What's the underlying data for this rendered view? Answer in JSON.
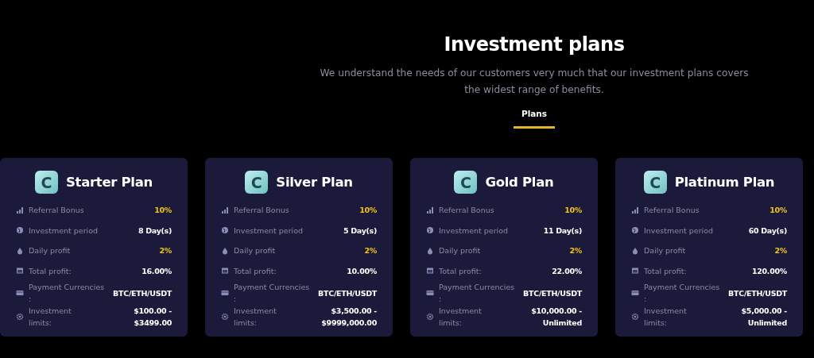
{
  "header": {
    "title": "Investment plans",
    "subtitle": "We understand the needs of our customers very much that our investment plans covers the widest range of benefits."
  },
  "tabs": [
    {
      "label": "Plans",
      "selected": true
    }
  ],
  "plans": [
    {
      "name": "Starter Plan",
      "logo": "C",
      "rows": [
        {
          "kind": "bars",
          "label": "Referral Bonus",
          "value": "10%",
          "highlight": true
        },
        {
          "kind": "globe",
          "label": "Investment period",
          "value": "8 Day(s)",
          "highlight": false
        },
        {
          "kind": "drop",
          "label": "Daily profit",
          "value": "2%",
          "highlight": true
        },
        {
          "kind": "calendar",
          "label": "Total profit:",
          "value": "16.00%",
          "highlight": false
        },
        {
          "kind": "card",
          "label": "Payment Currencies :",
          "value": "BTC/ETH/USDT",
          "highlight": false
        },
        {
          "kind": "gear",
          "label": "Investment limits:",
          "value": "$100.00 - $3499.00",
          "highlight": false
        }
      ]
    },
    {
      "name": "Silver Plan",
      "logo": "C",
      "rows": [
        {
          "kind": "bars",
          "label": "Referral Bonus",
          "value": "10%",
          "highlight": true
        },
        {
          "kind": "globe",
          "label": "Investment period",
          "value": "5 Day(s)",
          "highlight": false
        },
        {
          "kind": "drop",
          "label": "Daily profit",
          "value": "2%",
          "highlight": true
        },
        {
          "kind": "calendar",
          "label": "Total profit:",
          "value": "10.00%",
          "highlight": false
        },
        {
          "kind": "card",
          "label": "Payment Currencies :",
          "value": "BTC/ETH/USDT",
          "highlight": false
        },
        {
          "kind": "gear",
          "label": "Investment limits:",
          "value": "$3,500.00 - $9999,000.00",
          "highlight": false
        }
      ]
    },
    {
      "name": "Gold Plan",
      "logo": "C",
      "rows": [
        {
          "kind": "bars",
          "label": "Referral Bonus",
          "value": "10%",
          "highlight": true
        },
        {
          "kind": "globe",
          "label": "Investment period",
          "value": "11 Day(s)",
          "highlight": false
        },
        {
          "kind": "drop",
          "label": "Daily profit",
          "value": "2%",
          "highlight": true
        },
        {
          "kind": "calendar",
          "label": "Total profit:",
          "value": "22.00%",
          "highlight": false
        },
        {
          "kind": "card",
          "label": "Payment Currencies :",
          "value": "BTC/ETH/USDT",
          "highlight": false
        },
        {
          "kind": "gear",
          "label": "Investment limits:",
          "value": "$10,000.00 - Unlimited",
          "highlight": false
        }
      ]
    },
    {
      "name": "Platinum Plan",
      "logo": "C",
      "rows": [
        {
          "kind": "bars",
          "label": "Referral Bonus",
          "value": "10%",
          "highlight": true
        },
        {
          "kind": "globe",
          "label": "Investment period",
          "value": "60 Day(s)",
          "highlight": false
        },
        {
          "kind": "drop",
          "label": "Daily profit",
          "value": "2%",
          "highlight": true
        },
        {
          "kind": "calendar",
          "label": "Total profit:",
          "value": "120.00%",
          "highlight": false
        },
        {
          "kind": "card",
          "label": "Payment Currencies :",
          "value": "BTC/ETH/USDT",
          "highlight": false
        },
        {
          "kind": "gear",
          "label": "Investment limits:",
          "value": "$5,000.00 - Unlimited",
          "highlight": false
        }
      ]
    }
  ]
}
